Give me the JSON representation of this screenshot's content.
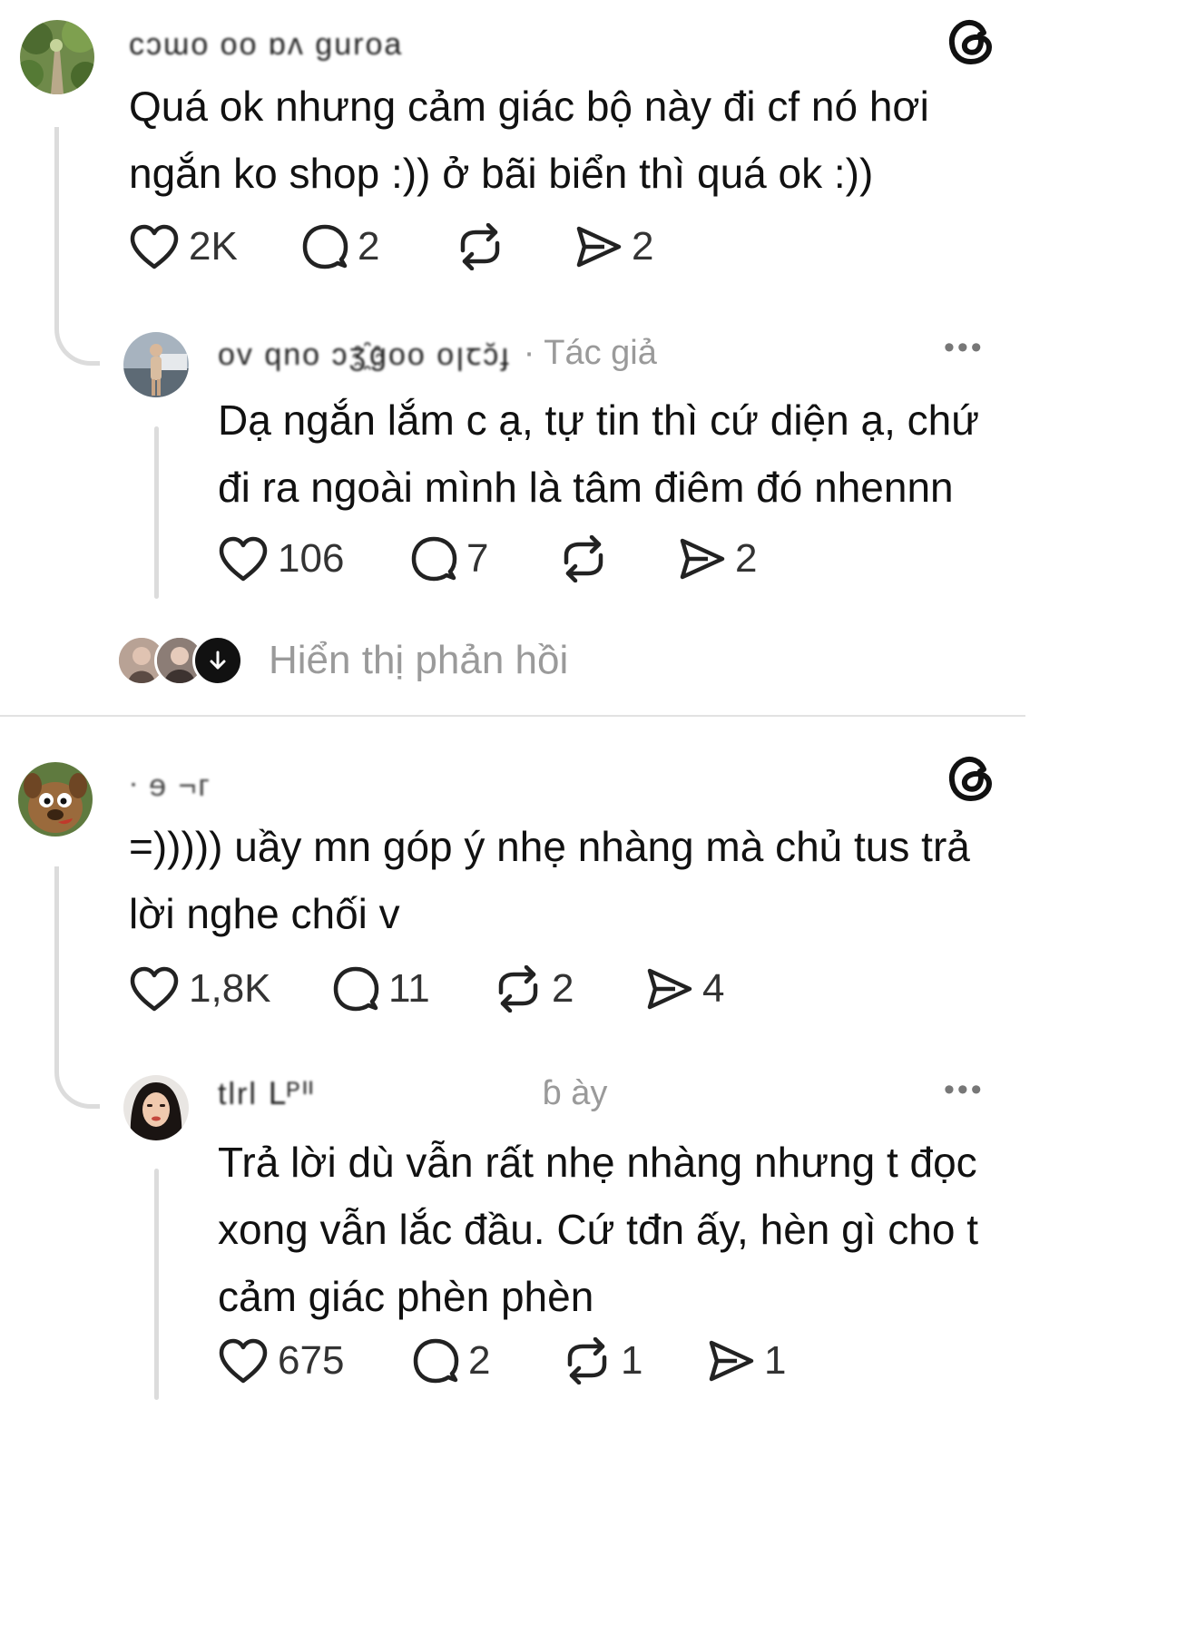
{
  "threads": [
    {
      "comment": {
        "username": "cɔɯo oo ɒʌ ɡuroa",
        "text_line1": "Quá ok nhưng cảm giác bộ này đi cf nó hơi",
        "text_line2": "ngắn ko shop :)) ở bãi biển thì quá ok :))",
        "likes": "2K",
        "replies": "2",
        "reposts": "",
        "shares": "2"
      },
      "reply": {
        "username": "ov qno ɔʒ҈ɡoo oꞁꞇɔ̆ɟ",
        "author_tag": "· Tác giả",
        "text_line1": "Dạ ngắn lắm c ạ, tự tin thì cứ diện ạ, chứ",
        "text_line2": "đi ra ngoài mình là tâm điêm đó nhennn",
        "text_line3": "",
        "likes": "106",
        "replies": "7",
        "reposts": "",
        "shares": "2"
      },
      "show_replies_label": "Hiển thị phản hồi"
    },
    {
      "comment": {
        "username": "ᐧ ɘ ¬ᴦ",
        "text_line1": "=))))) uầy mn góp ý nhẹ nhàng mà chủ tus trả",
        "text_line2": "lời nghe chối v",
        "likes": "1,8K",
        "replies": "11",
        "reposts": "2",
        "shares": "4"
      },
      "reply": {
        "username": "tlrl ꓡᴾᐦ",
        "author_tag": "ɓ ày",
        "text_line1": "Trả lời dù vẫn rất nhẹ nhàng nhưng t đọc",
        "text_line2": "xong vẫn lắc đầu. Cứ tđn ấy, hèn gì cho t",
        "text_line3": "cảm giác phèn phèn",
        "likes": "675",
        "replies": "2",
        "reposts": "1",
        "shares": "1"
      }
    }
  ],
  "icons": {
    "like": "heart-icon",
    "reply": "comment-bubble-icon",
    "repost": "repost-icon",
    "share": "send-icon",
    "brand": "threads-logo-icon",
    "more": "more-dots-icon"
  },
  "colors": {
    "text": "#111111",
    "muted": "#9a9a9a",
    "line": "#dcdcdc"
  }
}
